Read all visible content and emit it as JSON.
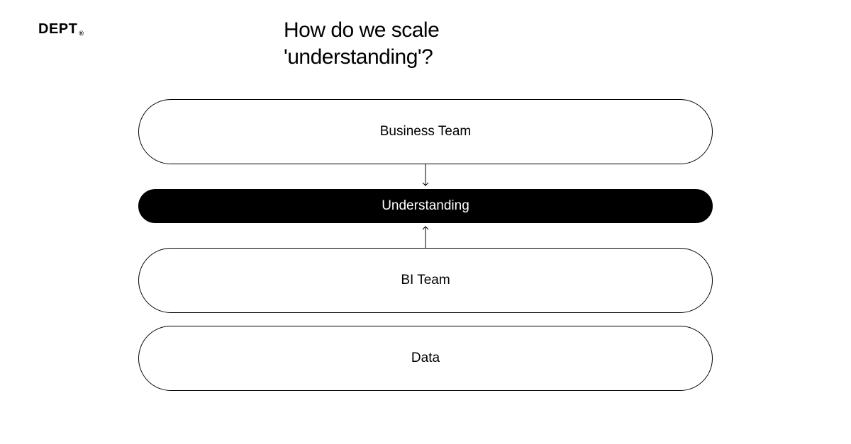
{
  "brand": {
    "name": "DEPT",
    "mark": "®"
  },
  "title": {
    "line1": "How do we scale",
    "line2": "'understanding'?"
  },
  "diagram": {
    "business_team": "Business Team",
    "understanding": "Understanding",
    "bi_team": "BI Team",
    "data": "Data"
  }
}
